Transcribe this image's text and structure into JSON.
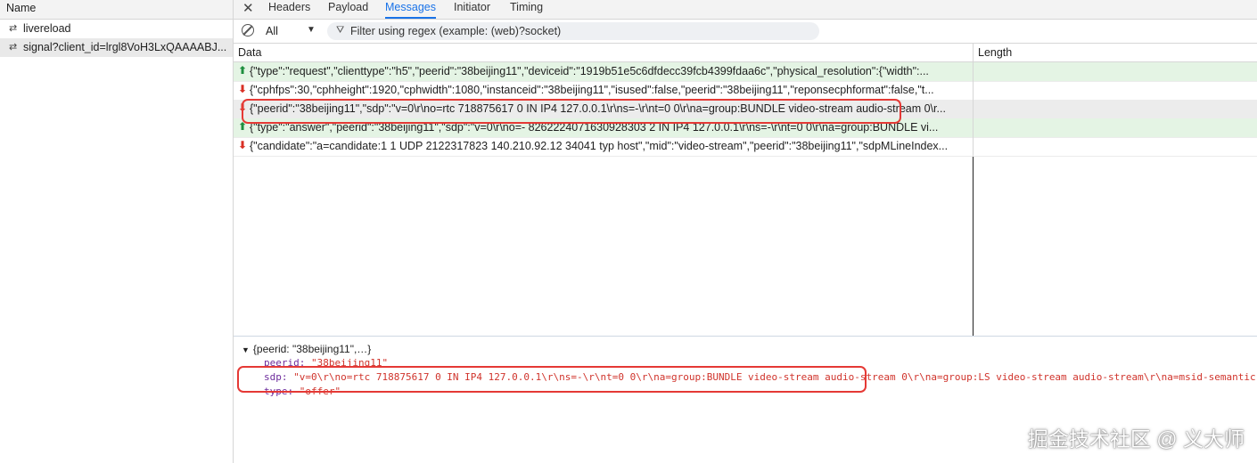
{
  "requests_panel": {
    "header": "Name",
    "items": [
      {
        "icon": "websocket-icon",
        "label": "livereload"
      },
      {
        "icon": "websocket-icon",
        "label": "signal?client_id=lrgl8VoH3LxQAAAABJ..."
      }
    ]
  },
  "tabs": {
    "close_glyph": "✕",
    "items": [
      "Headers",
      "Payload",
      "Messages",
      "Initiator",
      "Timing"
    ],
    "active": "Messages"
  },
  "filter_bar": {
    "type_value": "All",
    "type_caret": "▼",
    "filter_icon": "⛛",
    "placeholder": "Filter using regex (example: (web)?socket)"
  },
  "messages_table": {
    "columns": [
      "Data",
      "Length"
    ],
    "rows": [
      {
        "direction": "sent",
        "arrow": "⬆",
        "data": "{\"type\":\"request\",\"clienttype\":\"h5\",\"peerid\":\"38beijing11\",\"deviceid\":\"1919b51e5c6dfdecc39fcb4399fdaa6c\",\"physical_resolution\":{\"width\":...",
        "length": ""
      },
      {
        "direction": "received",
        "arrow": "⬇",
        "data": "{\"cphfps\":30,\"cphheight\":1920,\"cphwidth\":1080,\"instanceid\":\"38beijing11\",\"isused\":false,\"peerid\":\"38beijing11\",\"reponsecphformat\":false,\"t...",
        "length": ""
      },
      {
        "direction": "received",
        "arrow": "⬇",
        "selected": true,
        "data": "{\"peerid\":\"38beijing11\",\"sdp\":\"v=0\\r\\no=rtc 718875617 0 IN IP4 127.0.0.1\\r\\ns=-\\r\\nt=0 0\\r\\na=group:BUNDLE video-stream audio-stream 0\\r...",
        "length": ""
      },
      {
        "direction": "sent",
        "arrow": "⬆",
        "data": "{\"type\":\"answer\",\"peerid\":\"38beijing11\",\"sdp\":\"v=0\\r\\no=- 8262224071630928303 2 IN IP4 127.0.0.1\\r\\ns=-\\r\\nt=0 0\\r\\na=group:BUNDLE vi...",
        "length": ""
      },
      {
        "direction": "received",
        "arrow": "⬇",
        "data": "{\"candidate\":\"a=candidate:1 1 UDP 2122317823 140.210.92.12 34041 typ host\",\"mid\":\"video-stream\",\"peerid\":\"38beijing11\",\"sdpMLineIndex...",
        "length": ""
      }
    ]
  },
  "detail": {
    "summary": "{peerid: \"38beijing11\",…}",
    "lines": [
      {
        "key": "peerid",
        "value": "\"38beijing11\""
      },
      {
        "key": "sdp",
        "value": "\"v=0\\r\\no=rtc 718875617 0 IN IP4 127.0.0.1\\r\\ns=-\\r\\nt=0 0\\r\\na=group:BUNDLE video-stream audio-stream 0\\r\\na=group:LS video-stream audio-stream\\r\\na=msid-semantic"
      },
      {
        "key": "type",
        "value": "\"offer\""
      }
    ]
  },
  "watermark": "掘金技术社区 @ 义大师",
  "colors": {
    "accent": "#1a73e8",
    "sent_row_bg": "#e4f4e4",
    "up_arrow": "#1e8e3e",
    "down_arrow": "#d93025",
    "highlight_box": "#e53935"
  }
}
